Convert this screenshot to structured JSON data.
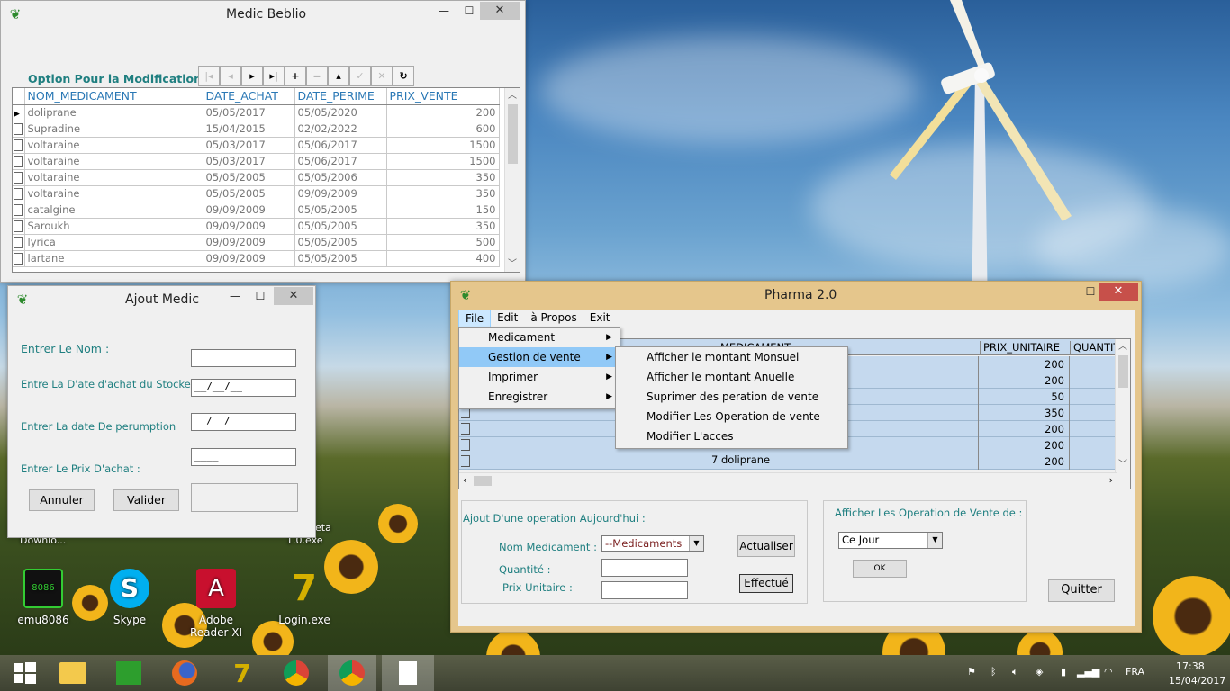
{
  "medic_beblio": {
    "title": "Medic Beblio",
    "option_label": "Option Pour la Modification",
    "columns": [
      "NOM_MEDICAMENT",
      "DATE_ACHAT",
      "DATE_PERIME",
      "PRIX_VENTE"
    ],
    "rows": [
      [
        "doliprane",
        "05/05/2017",
        "05/05/2020",
        "200"
      ],
      [
        "Supradine",
        "15/04/2015",
        "02/02/2022",
        "600"
      ],
      [
        "voltaraine",
        "05/03/2017",
        "05/06/2017",
        "1500"
      ],
      [
        "voltaraine",
        "05/03/2017",
        "05/06/2017",
        "1500"
      ],
      [
        "voltaraine",
        "05/05/2005",
        "05/05/2006",
        "350"
      ],
      [
        "voltaraine",
        "05/05/2005",
        "09/09/2009",
        "350"
      ],
      [
        "catalgine",
        "09/09/2009",
        "05/05/2005",
        "150"
      ],
      [
        "Saroukh",
        "09/09/2009",
        "05/05/2005",
        "350"
      ],
      [
        "lyrica",
        "09/09/2009",
        "05/05/2005",
        "500"
      ],
      [
        "lartane",
        "09/09/2009",
        "05/05/2005",
        "400"
      ]
    ],
    "nav_buttons": [
      "|◂",
      "◂",
      "▸",
      "▸|",
      "+",
      "−",
      "▴",
      "✓",
      "✕",
      "↻"
    ]
  },
  "ajout_medic": {
    "title": "Ajout Medic",
    "nom_label": "Entrer Le Nom :",
    "date_achat_label": "Entre La D'ate d'achat du Stocke",
    "date_perime_label": "Entrer La date De  perumption",
    "prix_label": "Entrer Le Prix D'achat :",
    "date_achat_mask": "__/__/__",
    "date_perime_mask": "__/__/__",
    "prix_mask": "____",
    "annuler": "Annuler",
    "valider": "Valider"
  },
  "pharma": {
    "title": "Pharma 2.0",
    "menu": [
      "File",
      "Edit",
      "à Propos",
      "Exit"
    ],
    "file_menu": [
      "Medicament",
      "Gestion de vente",
      "Imprimer",
      "Enregistrer"
    ],
    "vente_submenu": [
      "Afficher le montant  Monsuel",
      "Afficher le montant Anuelle",
      "Suprimer des peration de vente",
      "Modifier Les Operation de vente",
      "Modifier L'acces"
    ],
    "columns": [
      "MEDICAMENT",
      "PRIX_UNITAIRE",
      "QUANTIT"
    ],
    "prices": [
      "200",
      "200",
      "50",
      "350",
      "200",
      "200",
      "200"
    ],
    "last_row_text": "7  doliprane",
    "ajout_group": "Ajout D'une operation Aujourd'hui :",
    "nom_label": "Nom Medicament :",
    "nom_value": "--Medicaments",
    "quantite_label": "Quantité :",
    "prix_label": "Prix Unitaire :",
    "actualiser": "Actualiser",
    "effectue": "Effectué",
    "afficher_group": "Afficher Les Operation de Vente de :",
    "period_value": "Ce Jour",
    "ok": "OK",
    "quitter": "Quitter"
  },
  "desktop_icons": [
    {
      "label": "emu8086",
      "icon": "chip-icon",
      "color": "#1a1a1a"
    },
    {
      "label": "Skype",
      "icon": "skype-icon",
      "color": "#00aff0"
    },
    {
      "label": "Adobe Reader XI",
      "icon": "adobe-icon",
      "color": "#c8102e"
    },
    {
      "label": "Login.exe",
      "icon": "login-icon",
      "color": "#d4b000"
    }
  ],
  "partial_labels": {
    "downlo": "Downlo...",
    "exe": "1.0.exe",
    "eta": "eta"
  },
  "taskbar": {
    "lang": "FRA",
    "time": "17:38",
    "date": "15/04/2017"
  }
}
